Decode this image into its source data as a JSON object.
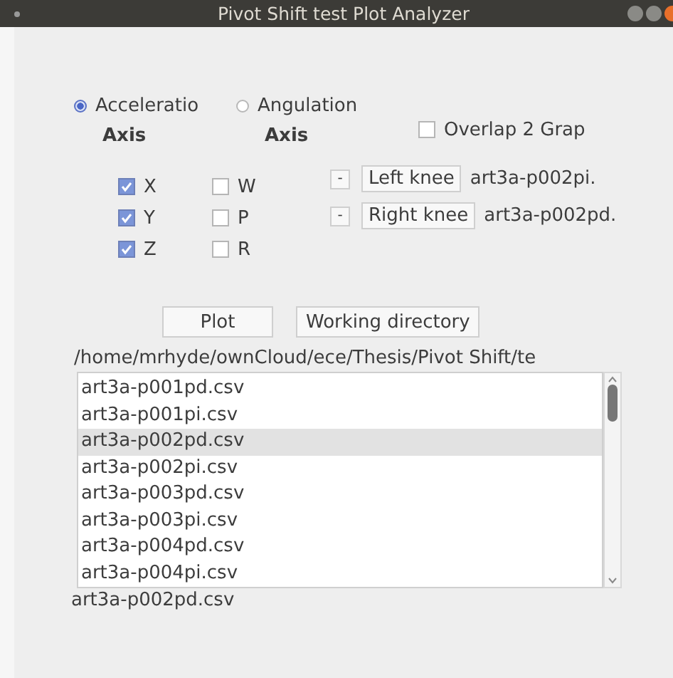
{
  "window": {
    "title": "Pivot Shift test Plot Analyzer"
  },
  "modes": [
    {
      "label": "Acceleratio",
      "selected": true
    },
    {
      "label": "Angulation",
      "selected": false
    }
  ],
  "axis_groups": [
    {
      "heading": "Axis",
      "axes": [
        {
          "label": "X",
          "checked": true
        },
        {
          "label": "Y",
          "checked": true
        },
        {
          "label": "Z",
          "checked": true
        }
      ]
    },
    {
      "heading": "Axis",
      "axes": [
        {
          "label": "W",
          "checked": false
        },
        {
          "label": "P",
          "checked": false
        },
        {
          "label": "R",
          "checked": false
        }
      ]
    }
  ],
  "overlap": {
    "label": "Overlap 2 Grap",
    "checked": false
  },
  "knees": [
    {
      "remove": "-",
      "label": "Left knee",
      "file": "art3a-p002pi."
    },
    {
      "remove": "-",
      "label": "Right knee",
      "file": "art3a-p002pd."
    }
  ],
  "buttons": [
    "Plot",
    "Working directory"
  ],
  "path": "/home/mrhyde/ownCloud/ece/Thesis/Pivot Shift/te",
  "files": [
    {
      "name": "art3a-p001pd.csv",
      "selected": false
    },
    {
      "name": "art3a-p001pi.csv",
      "selected": false
    },
    {
      "name": "art3a-p002pd.csv",
      "selected": true
    },
    {
      "name": "art3a-p002pi.csv",
      "selected": false
    },
    {
      "name": "art3a-p003pd.csv",
      "selected": false
    },
    {
      "name": "art3a-p003pi.csv",
      "selected": false
    },
    {
      "name": "art3a-p004pd.csv",
      "selected": false
    },
    {
      "name": "art3a-p004pi.csv",
      "selected": false
    }
  ],
  "selected_file": "art3a-p002pd.csv"
}
